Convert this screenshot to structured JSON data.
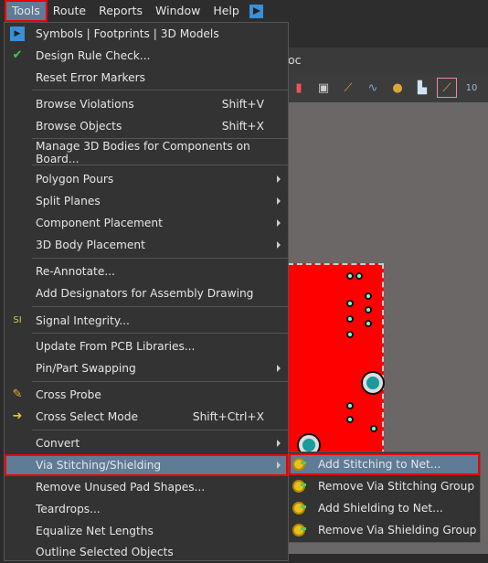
{
  "menubar": {
    "items": [
      "Tools",
      "Route",
      "Reports",
      "Window",
      "Help"
    ],
    "active": "Tools"
  },
  "tab": {
    "partial_text": "oc"
  },
  "toolbar": {
    "icons": [
      "chart-icon",
      "chip-icon",
      "route-icon",
      "interactive-route-icon",
      "via-icon",
      "fill-icon",
      "line-icon",
      "dimension-icon"
    ]
  },
  "tools_menu": {
    "items": [
      {
        "label": "Symbols | Footprints | 3D Models",
        "icon": "play-icon"
      },
      {
        "label": "Design Rule Check...",
        "icon": "drc-icon"
      },
      {
        "label": "Reset Error Markers"
      },
      {
        "label": "Browse Violations",
        "shortcut": "Shift+V"
      },
      {
        "label": "Browse Objects",
        "shortcut": "Shift+X"
      },
      {
        "label": "Manage 3D Bodies for Components on Board..."
      },
      {
        "label": "Polygon Pours",
        "submenu": true
      },
      {
        "label": "Split Planes",
        "submenu": true
      },
      {
        "label": "Component Placement",
        "submenu": true
      },
      {
        "label": "3D Body Placement",
        "submenu": true
      },
      {
        "label": "Re-Annotate..."
      },
      {
        "label": "Add Designators for Assembly Drawing"
      },
      {
        "label": "Signal Integrity...",
        "icon": "signal-integrity-icon"
      },
      {
        "label": "Update From PCB Libraries..."
      },
      {
        "label": "Pin/Part Swapping",
        "submenu": true
      },
      {
        "label": "Cross Probe",
        "icon": "cross-probe-icon"
      },
      {
        "label": "Cross Select Mode",
        "shortcut": "Shift+Ctrl+X",
        "icon": "cross-select-icon"
      },
      {
        "label": "Convert",
        "submenu": true
      },
      {
        "label": "Via Stitching/Shielding",
        "submenu": true,
        "highlighted": true
      },
      {
        "label": "Remove Unused Pad Shapes..."
      },
      {
        "label": "Teardrops..."
      },
      {
        "label": "Equalize Net Lengths"
      },
      {
        "label": "Outline Selected Objects"
      }
    ]
  },
  "via_submenu": {
    "items": [
      {
        "label": "Add Stitching to Net...",
        "highlighted": true
      },
      {
        "label": "Remove Via Stitching Group"
      },
      {
        "label": "Add Shielding to Net..."
      },
      {
        "label": "Remove Via Shielding Group"
      }
    ]
  },
  "colors": {
    "highlight": "#5f7b96",
    "annotation": "#ee0000",
    "board": "#ff0000",
    "menu_bg": "#333333"
  }
}
